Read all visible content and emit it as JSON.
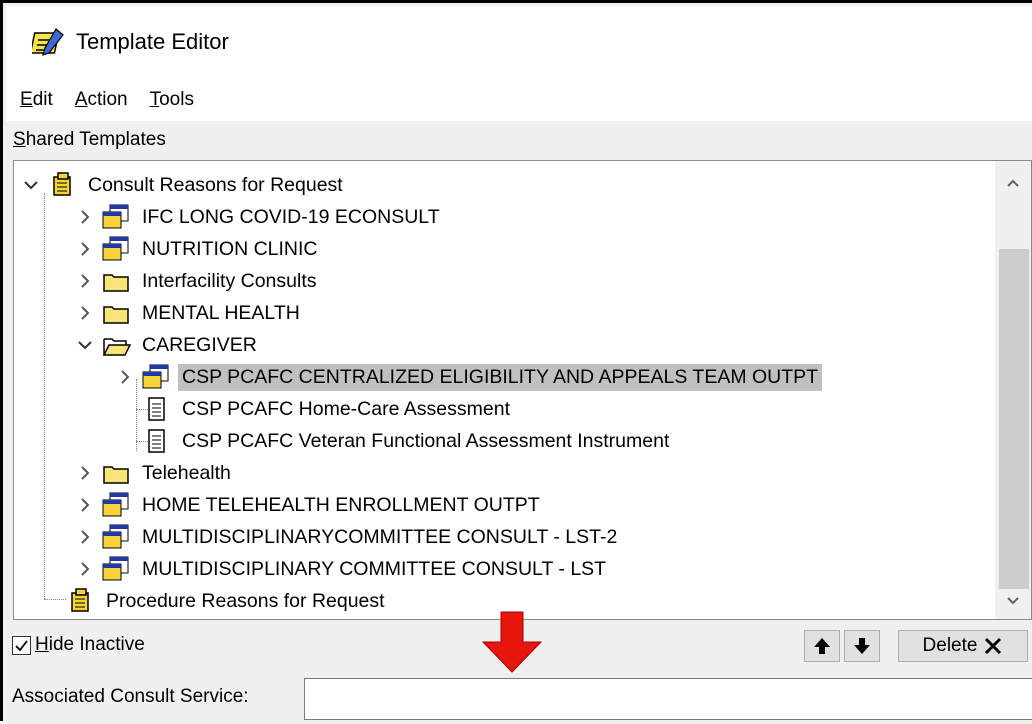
{
  "window": {
    "title": "Template Editor",
    "app_icon": "notepad-icon"
  },
  "menu": {
    "items": [
      {
        "label": "Edit",
        "mnemonic": "E",
        "rest": "dit"
      },
      {
        "label": "Action",
        "mnemonic": "A",
        "rest": "ction"
      },
      {
        "label": "Tools",
        "mnemonic": "T",
        "rest": "ools"
      }
    ]
  },
  "shared_templates": {
    "label": "Shared Templates",
    "mnemonic": "S",
    "rest": "hared Templates"
  },
  "tree": {
    "rows": [
      {
        "label": "Consult Reasons for Request",
        "icon": "root-reasons-icon",
        "expand": "expanded"
      },
      {
        "label": "IFC LONG COVID-19 ECONSULT",
        "icon": "dialog-template-icon",
        "expand": "collapsed"
      },
      {
        "label": "NUTRITION CLINIC",
        "icon": "dialog-template-icon",
        "expand": "collapsed"
      },
      {
        "label": "Interfacility Consults",
        "icon": "folder-closed-icon",
        "expand": "collapsed"
      },
      {
        "label": "MENTAL HEALTH",
        "icon": "folder-closed-icon",
        "expand": "collapsed"
      },
      {
        "label": "CAREGIVER",
        "icon": "folder-open-icon",
        "expand": "expanded"
      },
      {
        "label": "CSP PCAFC CENTRALIZED ELIGIBILITY AND APPEALS TEAM OUTPT",
        "icon": "dialog-template-icon",
        "expand": "collapsed",
        "selected": true
      },
      {
        "label": "CSP PCAFC Home-Care Assessment",
        "icon": "document-icon",
        "expand": "none"
      },
      {
        "label": "CSP PCAFC Veteran Functional Assessment Instrument",
        "icon": "document-icon",
        "expand": "none"
      },
      {
        "label": "Telehealth",
        "icon": "folder-closed-icon",
        "expand": "collapsed"
      },
      {
        "label": "HOME TELEHEALTH ENROLLMENT OUTPT",
        "icon": "dialog-template-icon",
        "expand": "collapsed"
      },
      {
        "label": "MULTIDISCIPLINARYCOMMITTEE CONSULT - LST-2",
        "icon": "dialog-template-icon",
        "expand": "collapsed"
      },
      {
        "label": "MULTIDISCIPLINARY COMMITTEE CONSULT - LST",
        "icon": "dialog-template-icon",
        "expand": "collapsed"
      },
      {
        "label": "Procedure Reasons for Request",
        "icon": "root-reasons-icon",
        "expand": "none"
      }
    ]
  },
  "hide_inactive": {
    "label": "Hide Inactive",
    "mnemonic": "H",
    "rest": "ide Inactive",
    "checked": true
  },
  "buttons": {
    "move_up_icon": "arrow-up-icon",
    "move_down_icon": "arrow-down-icon",
    "delete_label": "Delete"
  },
  "associated_consult_service": {
    "label": "Associated Consult Service:",
    "value": ""
  },
  "colors": {
    "selection": "#c0c0c0",
    "annotation_arrow": "#e8170d"
  }
}
